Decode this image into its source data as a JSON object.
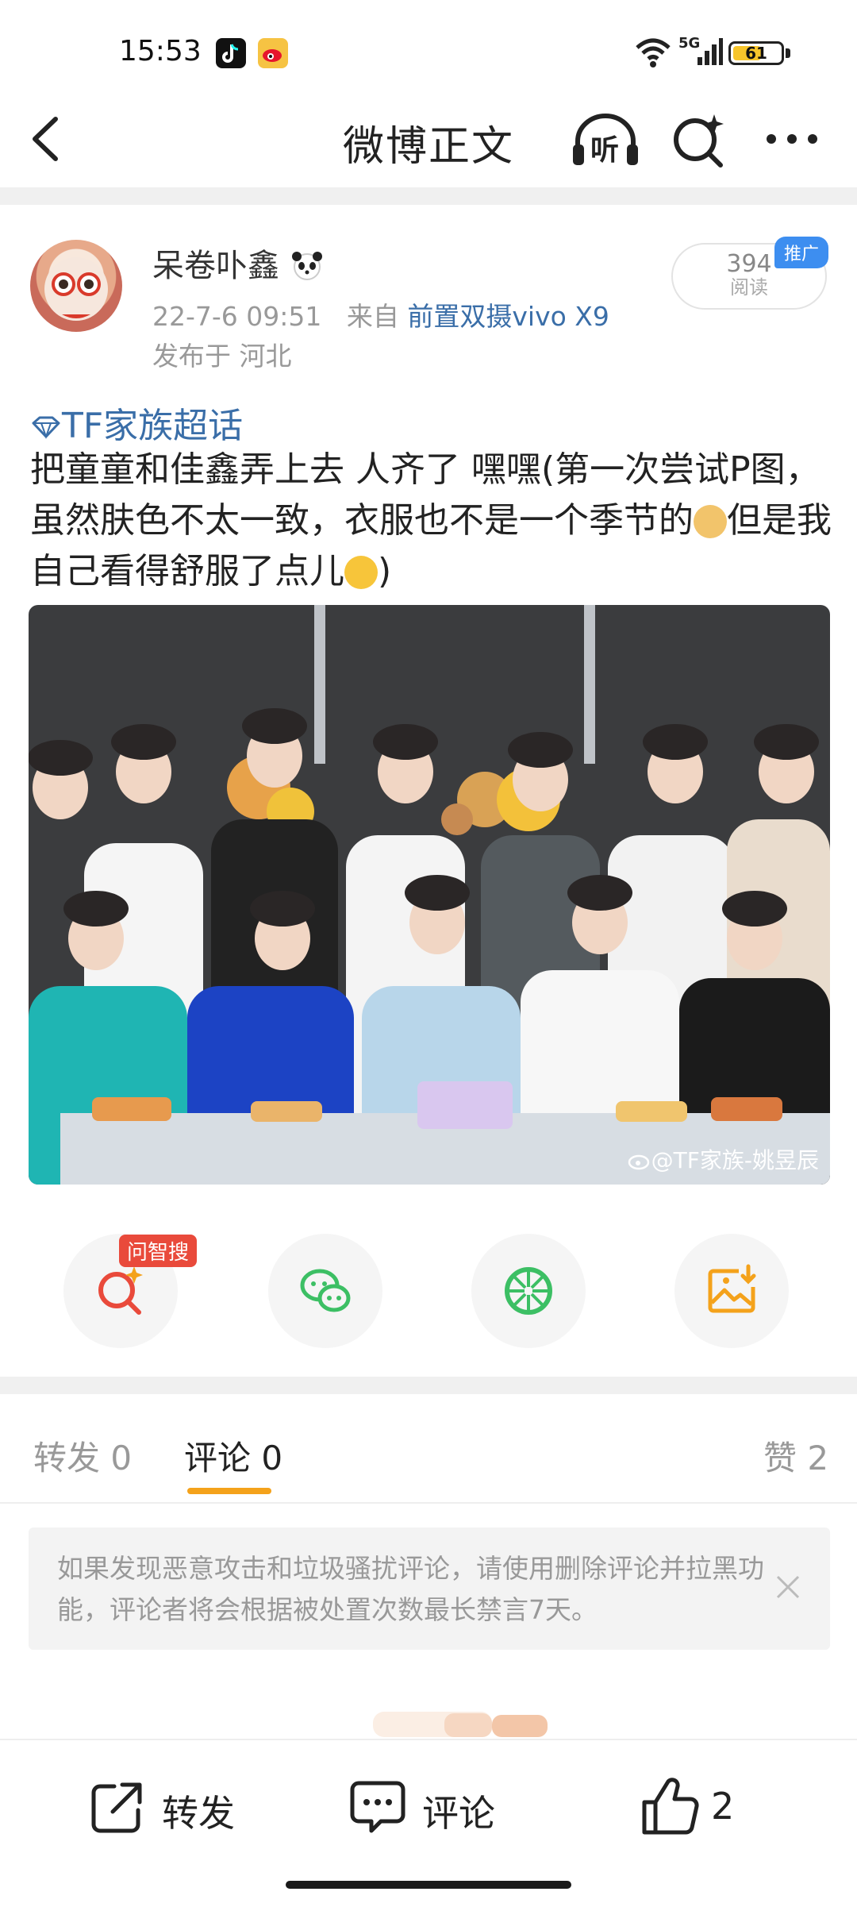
{
  "status_bar": {
    "time": "15:53",
    "network": "5G",
    "battery": "61",
    "battery_level_percent": 61
  },
  "nav": {
    "title": "微博正文",
    "listen_label": "听"
  },
  "post": {
    "author": "呆卷卟鑫",
    "datetime": "22-7-6 09:51",
    "source_prefix": "来自",
    "source": "前置双摄vivo X9",
    "location": "发布于 河北",
    "read_count": "394",
    "read_label": "阅读",
    "promo_tag": "推广",
    "topic": "TF家族超话",
    "text_part1": "把童童和佳鑫弄上去 人齐了 嘿嘿(第一次尝试P图，虽然肤色不太一致，衣服也不是一个季节的",
    "text_part2": "但是我自己看得舒服了点儿",
    "text_part3": ")",
    "photo_watermark": "@TF家族-姚昱辰"
  },
  "actions": {
    "ask_badge": "问智搜"
  },
  "tabs": {
    "repost": "转发 0",
    "comment": "评论 0",
    "like": "赞 2"
  },
  "notice": {
    "text": "如果发现恶意攻击和垃圾骚扰评论，请使用删除评论并拉黑功能，评论者将会根据被处置次数最长禁言7天。"
  },
  "bottom_bar": {
    "repost": "转发",
    "comment": "评论",
    "like_count": "2"
  },
  "colors": {
    "link": "#3a6ea8",
    "accent": "#f4a21b",
    "badge_red": "#e94a3b",
    "promo_blue": "#3d8ef0"
  }
}
